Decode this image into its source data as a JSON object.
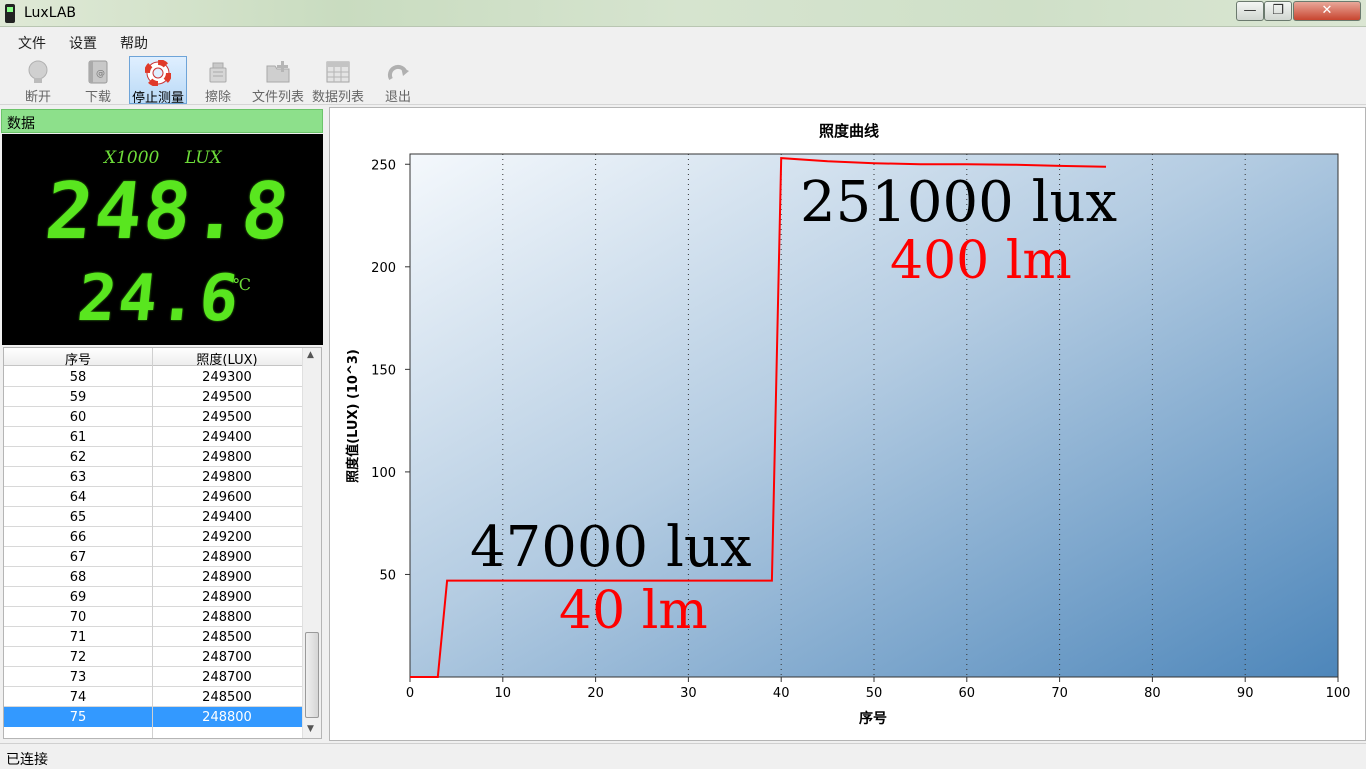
{
  "window": {
    "title": "LuxLAB",
    "minimize": "—",
    "maximize": "❐",
    "close": "✕"
  },
  "menu": [
    "文件",
    "设置",
    "帮助"
  ],
  "toolbar": [
    {
      "label": "断开",
      "icon": "bulb-icon",
      "active": false
    },
    {
      "label": "下载",
      "icon": "book-icon",
      "active": false
    },
    {
      "label": "停止测量",
      "icon": "lifebuoy-icon",
      "active": true
    },
    {
      "label": "擦除",
      "icon": "eraser-icon",
      "active": false
    },
    {
      "label": "文件列表",
      "icon": "folder-add-icon",
      "active": false
    },
    {
      "label": "数据列表",
      "icon": "grid-icon",
      "active": false
    },
    {
      "label": "退出",
      "icon": "redo-icon",
      "active": false
    }
  ],
  "data_panel": {
    "header": "数据",
    "lcd": {
      "multiplier": "X1000",
      "unit": "LUX",
      "reading": "248.8",
      "temperature": "24.6",
      "temp_unit": "℃"
    }
  },
  "table": {
    "columns": [
      "序号",
      "照度(LUX)"
    ],
    "rows": [
      [
        "58",
        "249300"
      ],
      [
        "59",
        "249500"
      ],
      [
        "60",
        "249500"
      ],
      [
        "61",
        "249400"
      ],
      [
        "62",
        "249800"
      ],
      [
        "63",
        "249800"
      ],
      [
        "64",
        "249600"
      ],
      [
        "65",
        "249400"
      ],
      [
        "66",
        "249200"
      ],
      [
        "67",
        "248900"
      ],
      [
        "68",
        "248900"
      ],
      [
        "69",
        "248900"
      ],
      [
        "70",
        "248800"
      ],
      [
        "71",
        "248500"
      ],
      [
        "72",
        "248700"
      ],
      [
        "73",
        "248700"
      ],
      [
        "74",
        "248500"
      ],
      [
        "75",
        "248800"
      ]
    ],
    "selected_row": "75"
  },
  "chart_data": {
    "type": "line",
    "title": "照度曲线",
    "xlabel": "序号",
    "ylabel": "照度值(LUX)  (10^3)",
    "xlim": [
      0,
      100
    ],
    "ylim": [
      0,
      255
    ],
    "xticks": [
      0,
      10,
      20,
      30,
      40,
      50,
      60,
      70,
      80,
      90,
      100
    ],
    "yticks": [
      50,
      100,
      150,
      200,
      250
    ],
    "grid": true,
    "series_color": "#ff0000",
    "series": [
      {
        "x": [
          0,
          3,
          4,
          10,
          20,
          30,
          35,
          39,
          40,
          45,
          50,
          55,
          60,
          65,
          70,
          75
        ],
        "y": [
          0,
          0,
          47,
          47,
          47,
          47,
          47,
          47,
          253,
          251.5,
          250.5,
          250,
          250,
          249.8,
          249.2,
          248.8
        ]
      }
    ],
    "annotations": [
      {
        "text": "47000 lux",
        "color": "#000000"
      },
      {
        "text": "40 lm",
        "color": "#ff0000"
      },
      {
        "text": "251000 lux",
        "color": "#000000"
      },
      {
        "text": "400 lm",
        "color": "#ff0000"
      }
    ]
  },
  "status": "已连接"
}
